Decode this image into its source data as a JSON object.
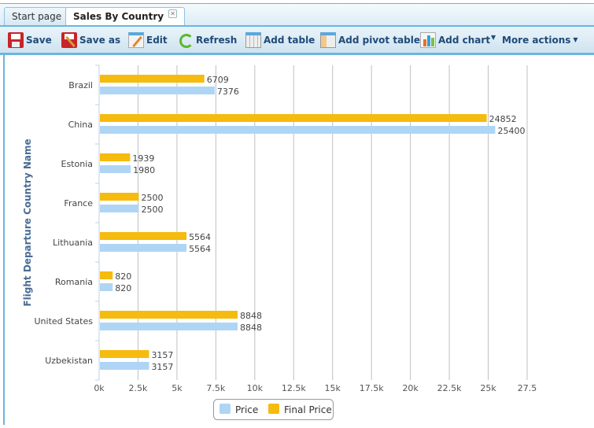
{
  "tabs": [
    {
      "label": "Start page",
      "active": false
    },
    {
      "label": "Sales By Country",
      "active": true,
      "close": "close-icon"
    }
  ],
  "toolbar": {
    "save": "Save",
    "save_as": "Save as",
    "edit": "Edit",
    "refresh": "Refresh",
    "add_table": "Add table",
    "add_pivot_table": "Add pivot table",
    "add_chart": "Add chart",
    "more_actions": "More actions"
  },
  "chart_data": {
    "type": "bar",
    "orientation": "horizontal",
    "categories": [
      "Brazil",
      "China",
      "Estonia",
      "France",
      "Lithuania",
      "Romania",
      "United States",
      "Uzbekistan"
    ],
    "series": [
      {
        "name": "Final Price",
        "color": "#f5bb0e",
        "values": [
          6709,
          24852,
          1939,
          2500,
          5564,
          820,
          8848,
          3157
        ]
      },
      {
        "name": "Price",
        "color": "#afd5f5",
        "values": [
          7376,
          25400,
          1980,
          2500,
          5564,
          820,
          8848,
          3157
        ]
      }
    ],
    "xlim": [
      0,
      27500
    ],
    "xticks": [
      "0k",
      "2.5k",
      "5k",
      "7.5k",
      "10k",
      "12.5k",
      "15k",
      "17.5k",
      "20k",
      "22.5k",
      "25k",
      "27.5"
    ],
    "ylabel": "Flight Departure Country Name",
    "xlabel": "",
    "grid": true,
    "data_labels": true,
    "legend": {
      "placement": "bottom",
      "items": [
        "Price",
        "Final Price"
      ]
    }
  }
}
